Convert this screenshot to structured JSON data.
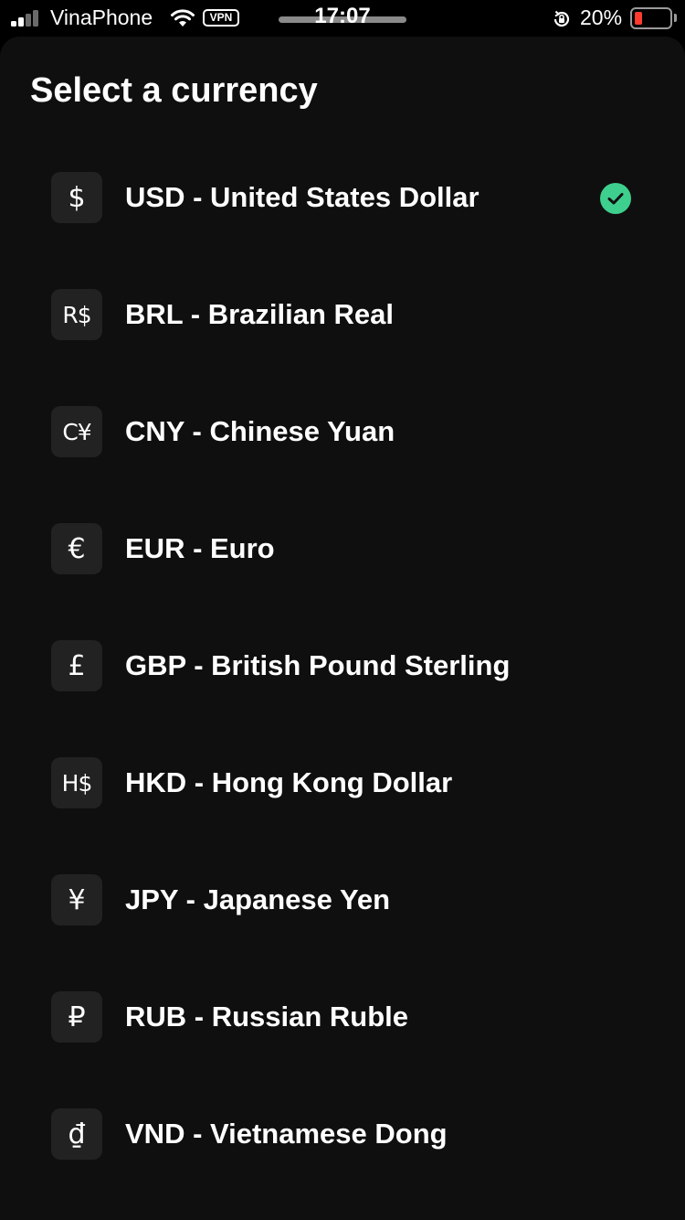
{
  "status_bar": {
    "carrier": "VinaPhone",
    "vpn_badge": "VPN",
    "time": "17:07",
    "battery_percent": "20%",
    "battery_level": 0.2,
    "icons": [
      "signal-icon",
      "wifi-icon",
      "rotation-lock-icon",
      "battery-icon"
    ]
  },
  "page": {
    "title": "Select a currency"
  },
  "colors": {
    "selected_check": "#3ecf8e",
    "battery_low": "#ff3b30"
  },
  "currencies": [
    {
      "symbol": "$",
      "label": "USD - United States Dollar",
      "selected": true
    },
    {
      "symbol": "R$",
      "label": "BRL - Brazilian Real",
      "selected": false
    },
    {
      "symbol": "C¥",
      "label": "CNY - Chinese Yuan",
      "selected": false
    },
    {
      "symbol": "€",
      "label": "EUR - Euro",
      "selected": false
    },
    {
      "symbol": "£",
      "label": "GBP - British Pound Sterling",
      "selected": false
    },
    {
      "symbol": "H$",
      "label": "HKD - Hong Kong Dollar",
      "selected": false
    },
    {
      "symbol": "¥",
      "label": "JPY - Japanese Yen",
      "selected": false
    },
    {
      "symbol": "₽",
      "label": "RUB - Russian Ruble",
      "selected": false
    },
    {
      "symbol": "₫",
      "label": "VND - Vietnamese Dong",
      "selected": false
    }
  ]
}
